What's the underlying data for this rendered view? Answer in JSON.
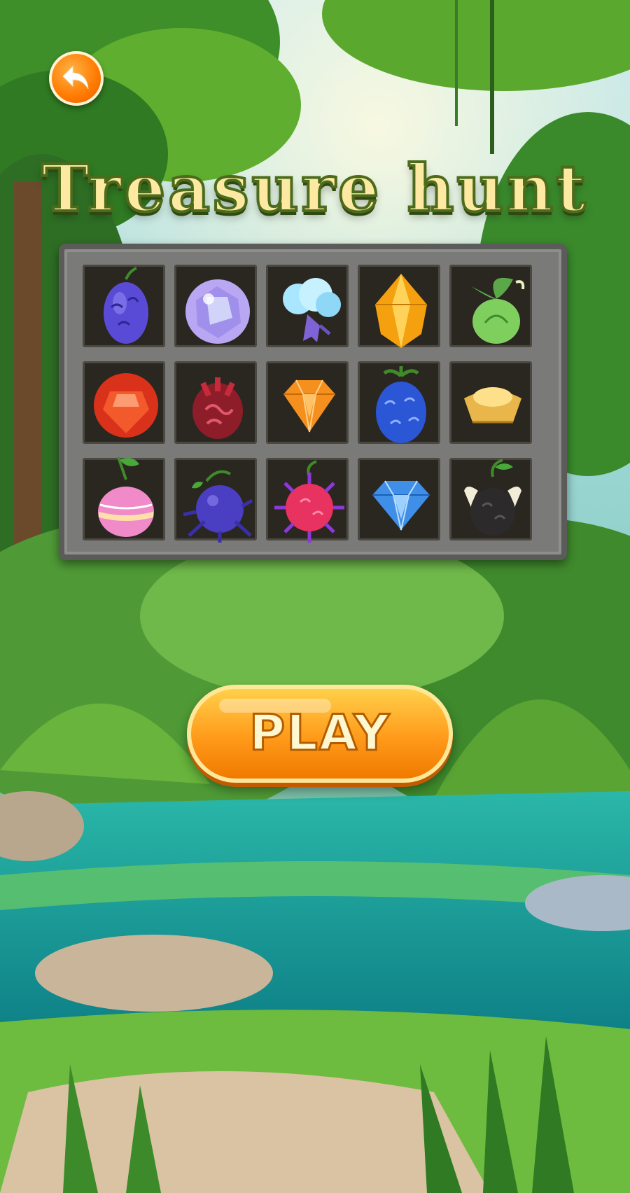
{
  "title": "Treasure hunt",
  "play_label": "PLAY",
  "colors": {
    "accent": "#ff8a00",
    "title_fill": "#fde9a2",
    "title_outline": "#4c6b1b"
  },
  "grid": {
    "rows": 3,
    "cols": 5,
    "items": [
      {
        "name": "purple-swirl-fruit-icon"
      },
      {
        "name": "prism-crystal-orb-icon"
      },
      {
        "name": "cloud-fruit-icon"
      },
      {
        "name": "amber-gem-icon"
      },
      {
        "name": "green-leaf-fruit-icon"
      },
      {
        "name": "red-ruby-icon"
      },
      {
        "name": "flame-fruit-icon"
      },
      {
        "name": "orange-diamond-icon"
      },
      {
        "name": "blue-berry-fruit-icon"
      },
      {
        "name": "gold-ingot-icon"
      },
      {
        "name": "pink-striped-fruit-icon"
      },
      {
        "name": "spiked-purple-fruit-icon"
      },
      {
        "name": "spiked-pink-fruit-icon"
      },
      {
        "name": "blue-diamond-icon"
      },
      {
        "name": "horned-black-fruit-icon"
      }
    ]
  }
}
